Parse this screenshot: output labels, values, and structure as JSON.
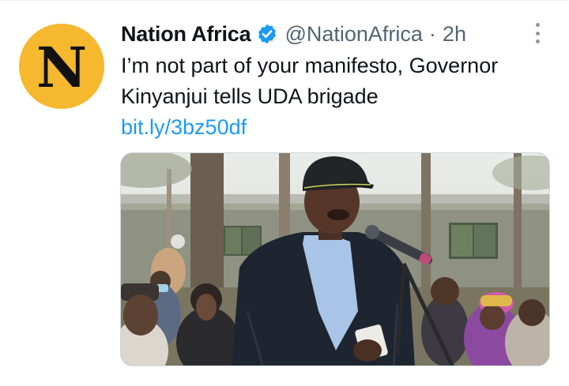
{
  "tweet": {
    "avatar_letter": "N",
    "display_name": "Nation Africa",
    "handle": "@NationAfrica",
    "separator": "·",
    "time": "2h",
    "text": "I’m not part of your manifesto, Governor Kinyanjui tells UDA brigade",
    "link": "bit.ly/3bz50df"
  },
  "colors": {
    "avatar_bg": "#f5b82e",
    "verified": "#1d9bf0",
    "link": "#1d9bf0",
    "text_primary": "#0f1419",
    "text_secondary": "#536471"
  },
  "icons": {
    "verified": "verified-badge-icon",
    "more": "more-options-icon"
  }
}
